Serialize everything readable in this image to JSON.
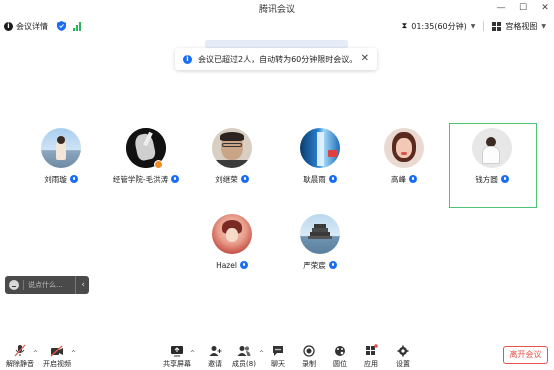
{
  "window": {
    "title": "腾讯会议"
  },
  "toolbar": {
    "meeting_details": "会议详情",
    "timer": "01:35(60分钟)",
    "view_mode": "宫格视图"
  },
  "notice": {
    "text": "会议已超过2人，自动转为60分钟限时会议。"
  },
  "participants": [
    {
      "name": "刘雨璇"
    },
    {
      "name": "经管学院-毛洪涛"
    },
    {
      "name": "刘继荣"
    },
    {
      "name": "耿晨雨"
    },
    {
      "name": "高峰"
    },
    {
      "name": "钱方圆"
    },
    {
      "name": "Hazel"
    },
    {
      "name": "严荣宸"
    }
  ],
  "chat": {
    "placeholder": "说点什么..."
  },
  "bottom": {
    "unmute": "解除静音",
    "start_video": "开启视频",
    "share_screen": "共享屏幕",
    "invite": "邀请",
    "members": "成员(8)",
    "chat": "聊天",
    "record": "录制",
    "apply": "应用",
    "settings": "设置",
    "leave": "离开会议",
    "stage": "圆位"
  },
  "colors": {
    "accent": "#1a6ef5",
    "speaking": "#4cc474",
    "leave": "#e5544a"
  }
}
